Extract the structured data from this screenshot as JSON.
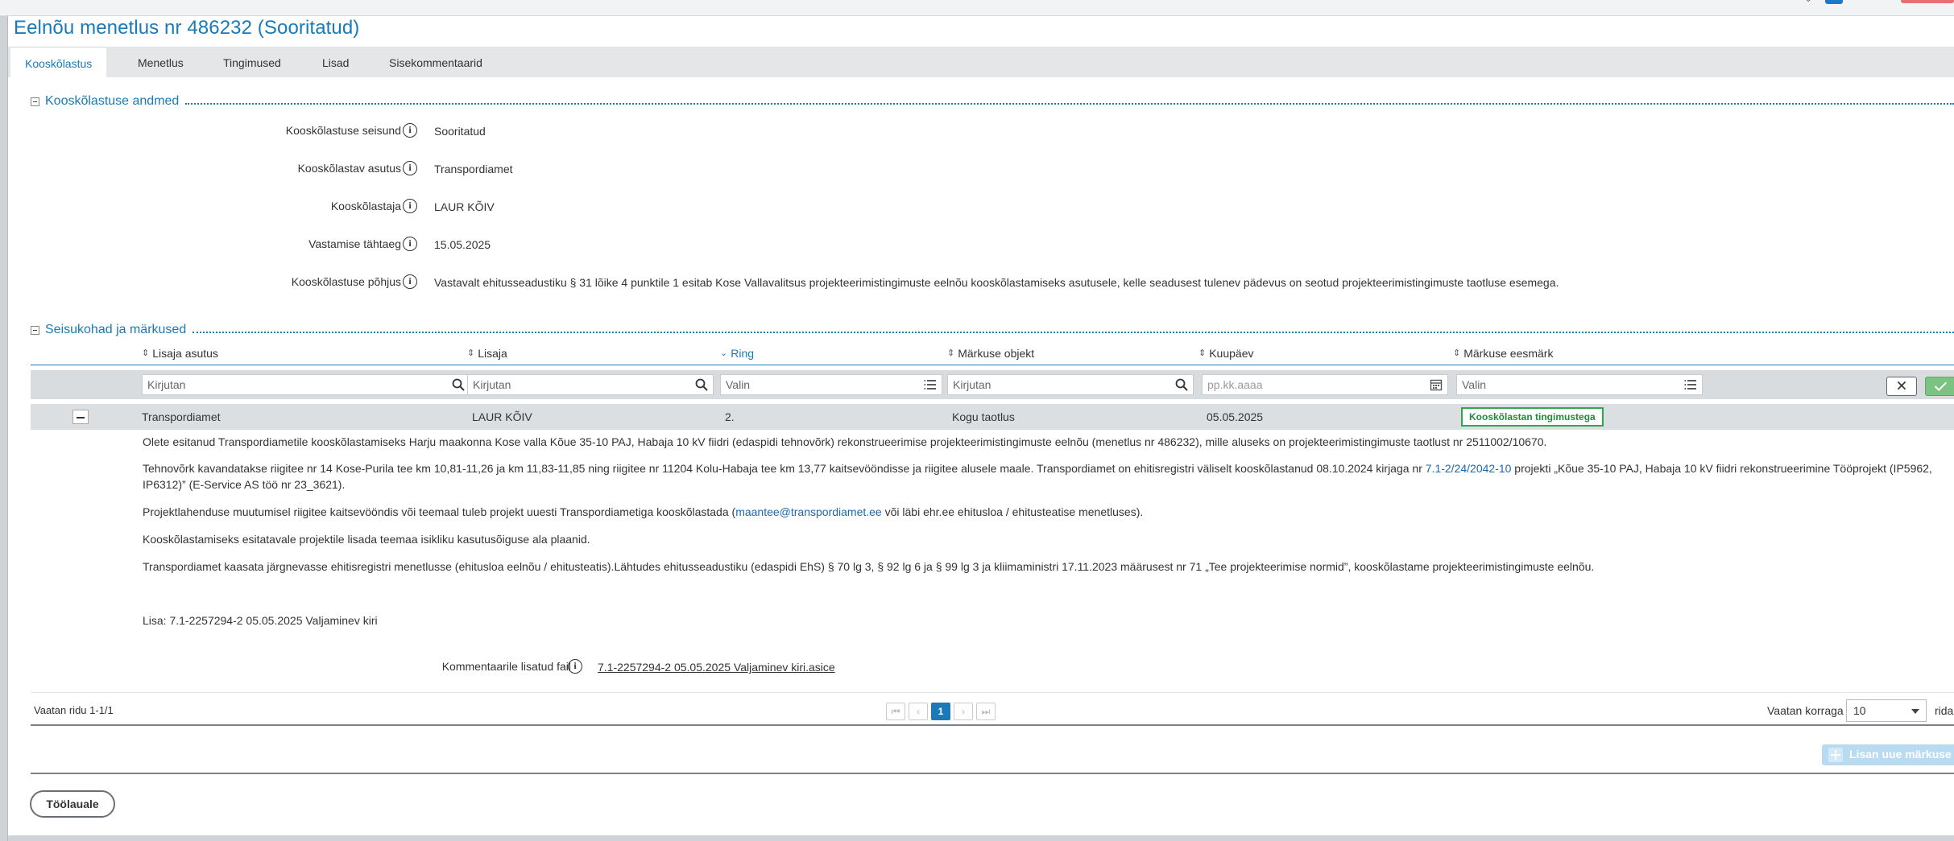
{
  "page": {
    "title": "Eelnõu menetlus nr 486232 (Sooritatud)"
  },
  "tabs": [
    {
      "label": "Kooskõlastus",
      "active": true
    },
    {
      "label": "Menetlus",
      "active": false
    },
    {
      "label": "Tingimused",
      "active": false
    },
    {
      "label": "Lisad",
      "active": false
    },
    {
      "label": "Sisekommentaarid",
      "active": false
    }
  ],
  "details_section": {
    "title": "Kooskõlastuse andmed",
    "fields": [
      {
        "label": "Kooskõlastuse seisund",
        "value": "Sooritatud"
      },
      {
        "label": "Kooskõlastav asutus",
        "value": "Transpordiamet"
      },
      {
        "label": "Kooskõlastaja",
        "value": "LAUR KÕIV"
      },
      {
        "label": "Vastamise tähtaeg",
        "value": "15.05.2025"
      },
      {
        "label": "Kooskõlastuse põhjus",
        "value": "Vastavalt ehitusseadustiku § 31 lõike 4 punktile 1 esitab Kose Vallavalitsus projekteerimistingimuste eelnõu kooskõlastamiseks asutusele, kelle seadusest tulenev pädevus on seotud projekteerimistingimuste taotluse esemega."
      }
    ]
  },
  "remarks_section": {
    "title": "Seisukohad ja märkused",
    "columns": [
      {
        "label": "Lisaja asutus",
        "sorted": false
      },
      {
        "label": "Lisaja",
        "sorted": false
      },
      {
        "label": "Ring",
        "sorted": true
      },
      {
        "label": "Märkuse objekt",
        "sorted": false
      },
      {
        "label": "Kuupäev",
        "sorted": false
      },
      {
        "label": "Märkuse eesmärk",
        "sorted": false
      }
    ],
    "filters": {
      "lisaja_asutus": "Kirjutan",
      "lisaja": "Kirjutan",
      "ring": "Valin",
      "objekt": "Kirjutan",
      "kuupaev": "pp.kk.aaaa",
      "eesmark": "Valin"
    },
    "row": {
      "asutus": "Transpordiamet",
      "lisaja": "LAUR KÕIV",
      "ring": "2.",
      "objekt": "Kogu taotlus",
      "kuupaev": "05.05.2025",
      "eesmark": "Kooskõlastan tingimustega"
    },
    "detail": {
      "p1": "Olete esitanud Transpordiametile kooskõlastamiseks Harju maakonna Kose valla Kõue 35-10 PAJ, Habaja 10 kV fiidri (edaspidi tehnovõrk) rekonstrueerimise projekteerimistingimuste eelnõu (menetlus nr 486232), mille aluseks on projekteerimistingimuste taotlust nr 2511002/10670.",
      "p2_before": "Tehnovõrk kavandatakse riigitee nr 14 Kose-Purila tee km 10,81-11,26 ja km 11,83-11,85 ning riigitee nr 11204 Kolu-Habaja tee km 13,77 kaitsevööndisse ja riigitee alusele maale. Transpordiamet on ehitisregistri väliselt kooskõlastanud 08.10.2024 kirjaga nr ",
      "p2_link": "7.1-2/24/2042-10",
      "p2_after": " projekti „Kõue 35-10 PAJ, Habaja 10 kV fiidri rekonstrueerimine Tööprojekt (IP5962, IP6312)” (E-Service AS töö nr 23_3621).",
      "p3_before": "Projektlahenduse muutumisel riigitee kaitsevööndis või teemaal tuleb projekt uuesti Transpordiametiga kooskõlastada (",
      "p3_link": "maantee@transpordiamet.ee",
      "p3_after": " või läbi ehr.ee ehitusloa / ehitusteatise menetluses).",
      "p4": "Kooskõlastamiseks esitatavale projektile lisada teemaa isikliku kasutusõiguse ala plaanid.",
      "p5": "Transpordiamet kaasata järgnevasse ehitisregistri menetlusse (ehitusloa eelnõu / ehitusteatis).Lähtudes ehitusseadustiku (edaspidi EhS) § 70 lg 3, § 92 lg 6 ja § 99 lg 3 ja kliimaministri 17.11.2023 määrusest nr 71 „Tee projekteerimise normid”, kooskõlastame projekteerimistingimuste eelnõu.",
      "p6": "Lisa: 7.1-2257294-2 05.05.2025 Valjaminev kiri",
      "file_label": "Kommentaarile lisatud fail",
      "file_name": "7.1-2257294-2 05.05.2025 Valjaminev kiri.asice"
    },
    "pager": {
      "summary": "Vaatan ridu 1-1/1",
      "current_page": "1",
      "per_page_label": "Vaatan korraga",
      "per_page_value": "10",
      "per_page_suffix": "rida"
    },
    "add_button": "Lisan uue märkuse"
  },
  "back_button": "Töölauale",
  "colors": {
    "accent": "#1a7ab8",
    "badge_green": "#2ea84a",
    "ok_green": "#7ac383"
  }
}
